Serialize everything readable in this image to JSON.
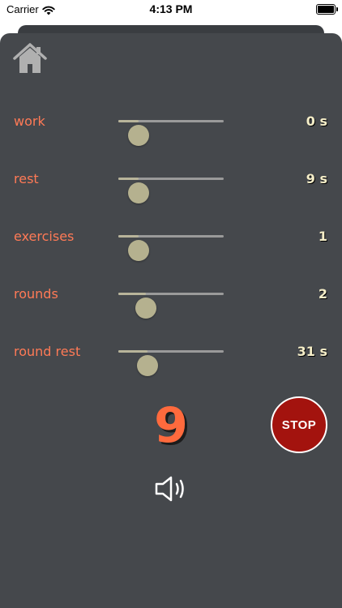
{
  "status_bar": {
    "carrier": "Carrier",
    "time": "4:13 PM"
  },
  "icons": {
    "home": "home-icon",
    "sound": "speaker-icon",
    "wifi": "wifi-icon",
    "battery": "battery-icon"
  },
  "colors": {
    "background": "#45484c",
    "label": "#ff7a56",
    "value": "#f5eec8",
    "thumb": "#b5b18f",
    "counter": "#ff6a3d",
    "stop": "#a3130e"
  },
  "settings": [
    {
      "label": "work",
      "value": "0 s",
      "level": 0.19
    },
    {
      "label": "rest",
      "value": "9 s",
      "level": 0.19
    },
    {
      "label": "exercises",
      "value": "1",
      "level": 0.19
    },
    {
      "label": "rounds",
      "value": "2",
      "level": 0.26
    },
    {
      "label": "round rest",
      "value": "31 s",
      "level": 0.28
    }
  ],
  "counter": "9",
  "stop_button": {
    "label": "STOP"
  }
}
